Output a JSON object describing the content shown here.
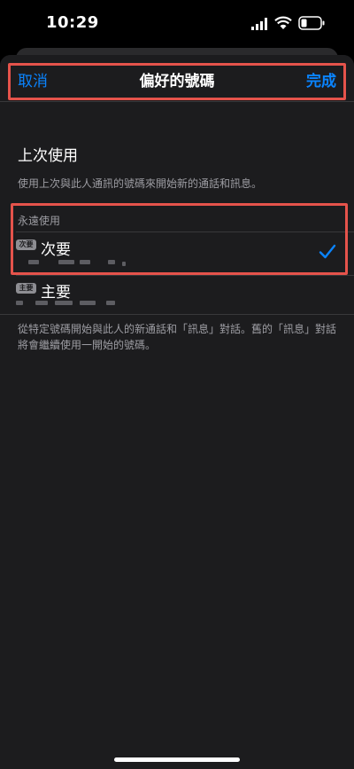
{
  "status": {
    "time": "10:29"
  },
  "nav": {
    "cancel": "取消",
    "title": "偏好的號碼",
    "done": "完成"
  },
  "last_used": {
    "label": "上次使用",
    "footnote": "使用上次與此人通訊的號碼來開始新的通話和訊息。"
  },
  "always_use": {
    "header": "永遠使用",
    "options": [
      {
        "badge": "次要",
        "label": "次要",
        "selected": true
      },
      {
        "badge": "主要",
        "label": "主要",
        "selected": false
      }
    ],
    "footnote": "從特定號碼開始與此人的新通話和「訊息」對話。舊的「訊息」對話將會繼續使用一開始的號碼。"
  },
  "colors": {
    "accent": "#0a84ff",
    "highlight": "#e5534b",
    "background": "#1c1c1e"
  },
  "icons": [
    "cellular-signal-icon",
    "wifi-icon",
    "battery-icon",
    "checkmark-icon"
  ]
}
